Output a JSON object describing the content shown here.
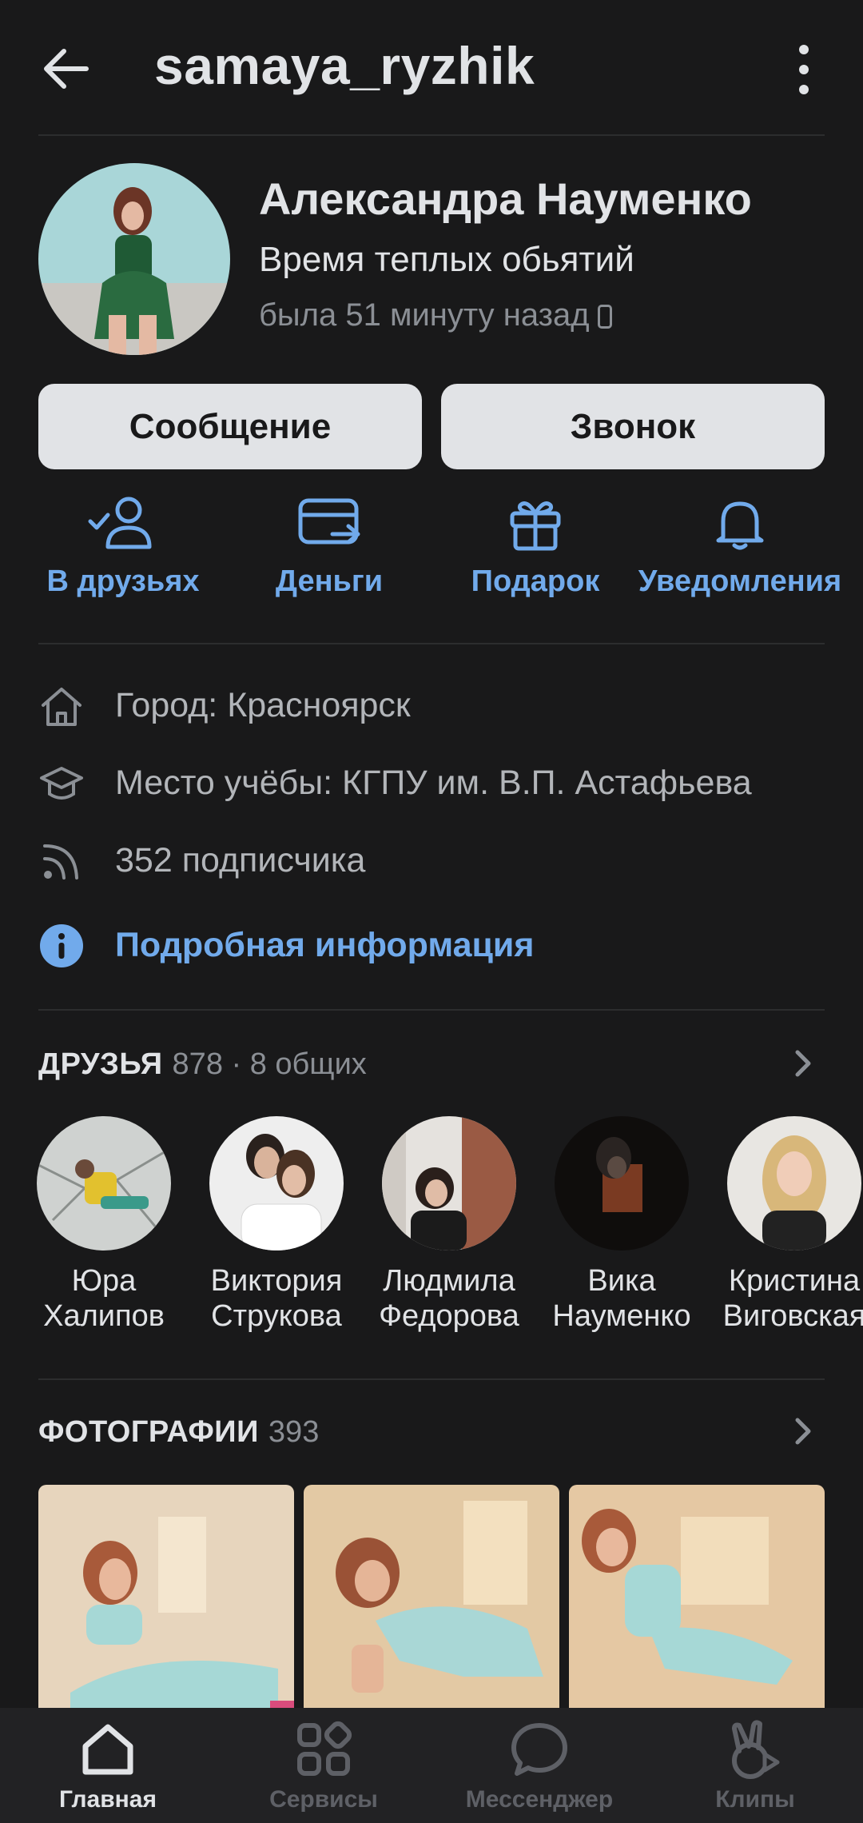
{
  "header": {
    "username": "samaya_ryzhik"
  },
  "profile": {
    "name": "Александра Науменко",
    "status": "Время теплых обьятий",
    "last_seen": "была 51 минуту назад"
  },
  "buttons": {
    "message": "Сообщение",
    "call": "Звонок"
  },
  "actions": [
    {
      "label": "В друзьях",
      "icon": "friend-check-icon"
    },
    {
      "label": "Деньги",
      "icon": "money-transfer-icon"
    },
    {
      "label": "Подарок",
      "icon": "gift-icon"
    },
    {
      "label": "Уведомления",
      "icon": "bell-icon"
    }
  ],
  "info": {
    "city": "Город: Красноярск",
    "education": "Место учёбы: КГПУ им. В.П. Астафьева",
    "followers": "352 подписчика",
    "details": "Подробная информация"
  },
  "friends": {
    "title": "ДРУЗЬЯ",
    "count": "878 · 8 общих",
    "items": [
      {
        "first": "Юра",
        "last": "Халипов"
      },
      {
        "first": "Виктория",
        "last": "Струкова"
      },
      {
        "first": "Людмила",
        "last": "Федорова"
      },
      {
        "first": "Вика",
        "last": "Науменко"
      },
      {
        "first": "Кристина",
        "last": "Виговская"
      }
    ]
  },
  "photos": {
    "title": "ФОТОГРАФИИ",
    "count": "393"
  },
  "tabbar": {
    "items": [
      {
        "label": "Главная",
        "icon": "home-icon",
        "active": true
      },
      {
        "label": "Сервисы",
        "icon": "services-icon",
        "active": false
      },
      {
        "label": "Мессенджер",
        "icon": "messenger-icon",
        "active": false
      },
      {
        "label": "Клипы",
        "icon": "clips-icon",
        "active": false
      }
    ]
  },
  "colors": {
    "background": "#19191a",
    "accent": "#71aaeb",
    "button_bg": "#e1e3e6"
  }
}
